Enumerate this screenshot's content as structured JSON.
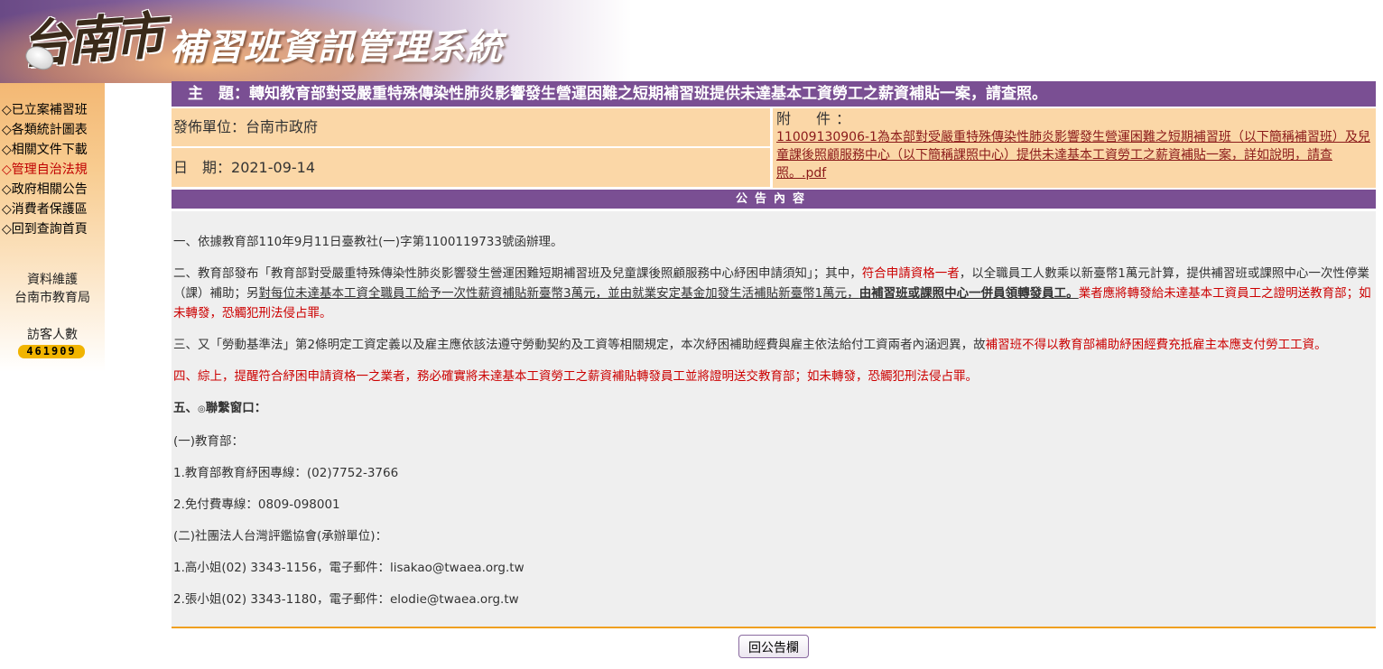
{
  "header": {
    "city_logo_text": "台南市",
    "system_title": "補習班資訊管理系統"
  },
  "sidebar": {
    "nav_items": [
      {
        "label": "◇已立案補習班"
      },
      {
        "label": "◇各類統計圖表"
      },
      {
        "label": "◇相關文件下載"
      },
      {
        "label": "◇管理自治法規",
        "active": true
      },
      {
        "label": "◇政府相關公告"
      },
      {
        "label": "◇消費者保護區"
      },
      {
        "label": "◇回到查詢首頁"
      }
    ],
    "maintenance_label": "資料維護",
    "maintenance_unit": "台南市教育局",
    "visitor_label": "訪客人數",
    "visitor_count": "461909"
  },
  "announcement": {
    "subject_label": "主　題：",
    "subject": "轉知教育部對受嚴重特殊傳染性肺炎影響發生營運困難之短期補習班提供未達基本工資勞工之薪資補貼一案，請查照。",
    "publisher_label": "發佈單位：",
    "publisher": "台南市政府",
    "date_label": "日　期：",
    "date": "2021-09-14",
    "attachment_label": "附　件：",
    "attachment_link": "11009130906-1為本部對受嚴重特殊傳染性肺炎影響發生營運困難之短期補習班（以下簡稱補習班）及兒童課後照顧服務中心（以下簡稱課照中心）提供未達基本工資勞工之薪資補貼一案，詳如說明，請查照。.pdf",
    "content_title": "公告內容"
  },
  "content": {
    "p1": "一、依據教育部110年9月11日臺教社(一)字第1100119733號函辦理。",
    "p2_a": "二、教育部發布「教育部對受嚴重特殊傳染性肺炎影響發生營運困難短期補習班及兒童課後照顧服務中心紓困申請須知」；其中，",
    "p2_b": "符合申請資格一者",
    "p2_c": "，以全職員工人數乘以新臺幣1萬元計算，提供補習班或課照中心一次性停業（課）補助；另",
    "p2_d": "對每位未達基本工資全職員工給予一次性薪資補貼新臺幣3萬元，並由就業安定基金加發生活補貼新臺幣1萬元，",
    "p2_e": "由補習班或課照中心一併員領轉發員工。",
    "p2_f": "業者應將轉發給未達基本工資員工之證明送教育部；如未轉發，恐觸犯刑法侵占罪。",
    "p3_a": "三、又「勞動基準法」第2條明定工資定義以及雇主應依該法遵守勞動契約及工資等相關規定，本次紓困補助經費與雇主依法給付工資兩者內涵迥異，故",
    "p3_b": "補習班不得以教育部補助紓困經費充抵雇主本應支付勞工工資。",
    "p4": "四、綜上，提醒符合紓困申請資格一之業者，務必確實將未達基本工資勞工之薪資補貼轉發員工並將證明送交教育部；如未轉發，恐觸犯刑法侵占罪。",
    "p5": "五、",
    "p5_icon": "◎",
    "p5_b": "聯繫窗口：",
    "l1": "(一)教育部：",
    "l2": "1.教育部教育紓困專線：(02)7752-3766",
    "l3": "2.免付費專線：0809-098001",
    "l4": "(二)社團法人台灣評鑑協會(承辦單位)：",
    "l5": "1.高小姐(02) 3343-1156，電子郵件：lisakao@twaea.org.tw",
    "l6": "2.張小姐(02) 3343-1180，電子郵件：elodie@twaea.org.tw"
  },
  "footer": {
    "back_button": "回公告欄"
  }
}
